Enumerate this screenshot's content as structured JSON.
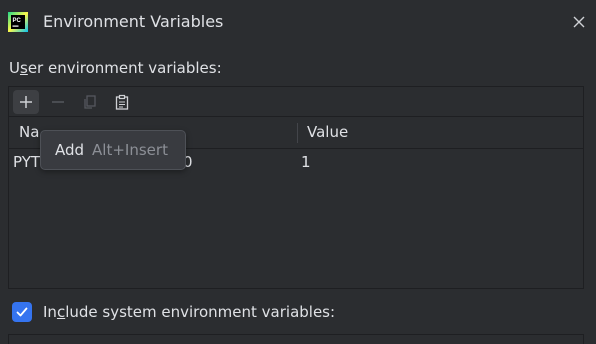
{
  "window": {
    "title": "Environment Variables",
    "app_icon": "pycharm-icon",
    "close_icon": "close-icon"
  },
  "user_section": {
    "label_prefix": "U",
    "label_underlined": "s",
    "label_suffix": "er environment variables:"
  },
  "toolbar": {
    "buttons": [
      {
        "icon": "plus-icon",
        "enabled": true
      },
      {
        "icon": "minus-icon",
        "enabled": false
      },
      {
        "icon": "copy-icon",
        "enabled": false
      },
      {
        "icon": "paste-icon",
        "enabled": true
      }
    ]
  },
  "table": {
    "columns": [
      "Name",
      "Value"
    ],
    "header_name_visible": "Na",
    "rows": [
      {
        "name_visible": "PYT",
        "name_tail_visible": "0",
        "value": "1"
      }
    ]
  },
  "tooltip": {
    "label": "Add",
    "shortcut": "Alt+Insert"
  },
  "system_section": {
    "checked": true,
    "label_prefix": "In",
    "label_underlined": "c",
    "label_suffix": "lude system environment variables:"
  },
  "colors": {
    "background": "#2b2d30",
    "text": "#dfe1e5",
    "accent": "#3574f0",
    "border": "#1e1f22",
    "tooltip_bg": "#393b40",
    "muted": "#8c8f96"
  }
}
